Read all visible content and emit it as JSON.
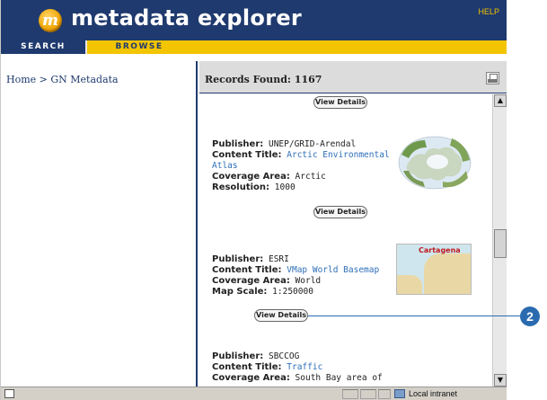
{
  "header": {
    "logo_letter": "m",
    "app_title": "metadata explorer",
    "help_label": "HELP"
  },
  "tabs": [
    {
      "label": "SEARCH"
    },
    {
      "label": "BROWSE"
    }
  ],
  "left_pane": {
    "breadcrumb": "Home > GN Metadata"
  },
  "right_pane": {
    "records_found": "Records Found: 1167",
    "view_details_label": "View Details",
    "records": [
      {
        "publisher_label": "Publisher:",
        "publisher": "UNEP/GRID-Arendal",
        "title_label": "Content Title:",
        "title": "Arctic Environmental Atlas",
        "coverage_label": "Coverage Area:",
        "coverage": "Arctic",
        "extra_label": "Resolution:",
        "extra": "1000"
      },
      {
        "publisher_label": "Publisher:",
        "publisher": "ESRI",
        "title_label": "Content Title:",
        "title": "VMap World Basemap",
        "coverage_label": "Coverage Area:",
        "coverage": "World",
        "extra_label": "Map Scale:",
        "extra": "1:250000",
        "thumb_label": "Cartagena"
      },
      {
        "publisher_label": "Publisher:",
        "publisher": "SBCCOG",
        "title_label": "Content Title:",
        "title": "Traffic",
        "coverage_label": "Coverage Area:",
        "coverage": "South Bay area of"
      }
    ]
  },
  "statusbar": {
    "zone": "Local intranet"
  },
  "callout": {
    "number": "2"
  },
  "colors": {
    "header_navy": "#1f3a6e",
    "tab_yellow": "#f3c400",
    "link_blue": "#2d6fb8",
    "callout_blue": "#2a6bb0"
  }
}
